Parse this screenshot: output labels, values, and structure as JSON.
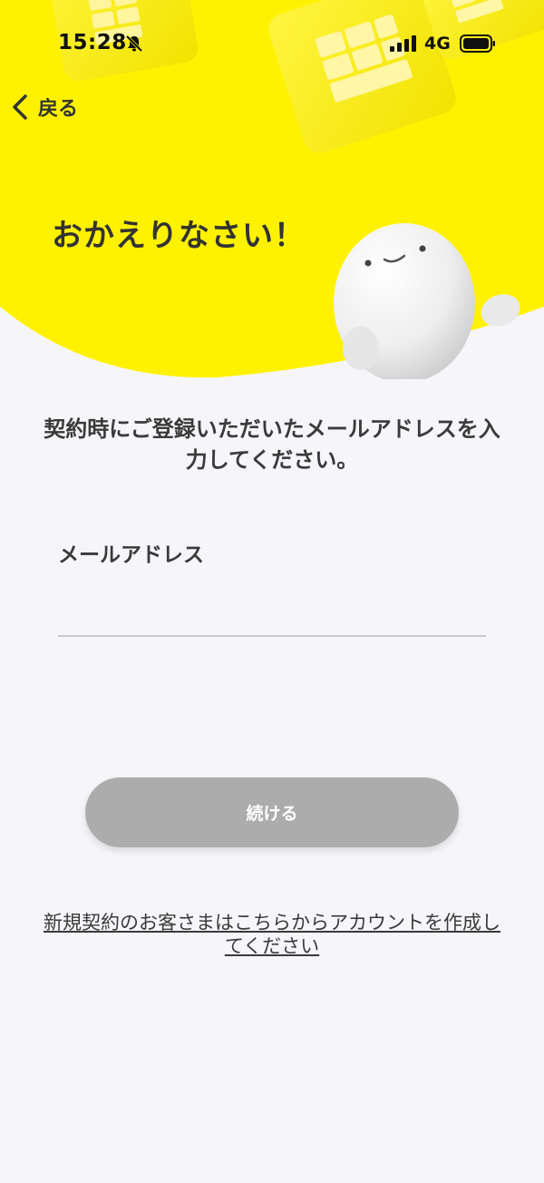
{
  "status_bar": {
    "time": "15:28",
    "network": "4G",
    "icons": [
      "bell-slash-icon",
      "signal-icon",
      "battery-icon"
    ]
  },
  "nav": {
    "back_label": "戻る",
    "back_icon": "chevron-left-icon"
  },
  "hero": {
    "title": "おかえりなさい！",
    "background_color": "#fff200",
    "decorations": [
      "sim-card-icon",
      "mascot-illustration"
    ]
  },
  "form": {
    "instruction": "契約時にご登録いただいたメールアドレスを入力してください。",
    "email_label": "メールアドレス",
    "email_value": "",
    "email_placeholder": ""
  },
  "actions": {
    "continue_label": "続ける",
    "continue_color": "#acacad",
    "signup_link": "新規契約のお客さまはこちらからアカウントを作成してください"
  }
}
